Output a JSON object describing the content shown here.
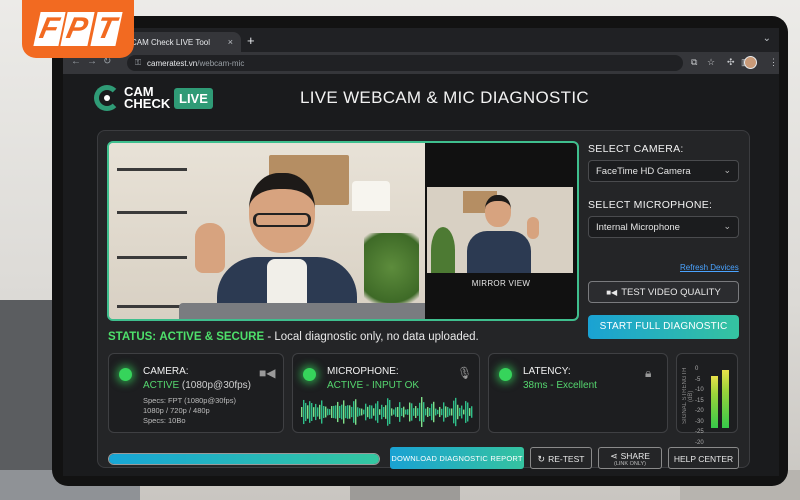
{
  "brand": {
    "fpt_logo": "FPT"
  },
  "browser": {
    "tab_title": "CAM Check LIVE Tool",
    "tab_close": "×",
    "new_tab": "+",
    "url_domain": "cameratest.vn",
    "url_path": "/webcam-mic"
  },
  "page": {
    "logo_line1": "CAM",
    "logo_line2": "CHECK",
    "logo_badge": "LIVE",
    "title": "LIVE WEBCAM & MIC DIAGNOSTIC"
  },
  "video": {
    "mirror_label": "MIRROR VIEW"
  },
  "controls": {
    "camera_label": "SELECT CAMERA:",
    "camera_value": "FaceTime HD Camera",
    "mic_label": "SELECT MICROPHONE:",
    "mic_value": "Internal Microphone",
    "refresh_link": "Refresh Devices",
    "test_button": "TEST VIDEO QUALITY",
    "full_button": "START FULL DIAGNOSTIC"
  },
  "status": {
    "prefix": "STATUS:",
    "state": "ACTIVE & SECURE",
    "note": "- Local diagnostic only, no data uploaded."
  },
  "cards": {
    "camera": {
      "title": "CAMERA:",
      "state": "ACTIVE",
      "detail": "(1080p@30fps)",
      "specs": "Specs: FPT (1080p@30fps)\n1080p / 720p / 480p\nSpecs: 10Bo"
    },
    "microphone": {
      "title": "MICROPHONE:",
      "state": "ACTIVE - INPUT OK"
    },
    "latency": {
      "title": "LATENCY:",
      "value": "38ms - Excellent"
    },
    "signal": {
      "label": "SIGNAL STRENGTH (dB)",
      "scale": "0\n-5\n-10\n-15\n-20\n-30\n-25\n-20",
      "left_level": 0.82,
      "right_level": 0.9
    }
  },
  "bottom": {
    "progress": 1.0,
    "download": "DOWNLOAD DIAGNOSTIC REPORT",
    "retest": "RE-TEST",
    "share": "SHARE",
    "share_sub": "(LINK ONLY)",
    "help": "HELP CENTER"
  },
  "colors": {
    "accent_green": "#3fbf8e",
    "status_green": "#4ee06b",
    "brand_orange": "#f26a21"
  }
}
